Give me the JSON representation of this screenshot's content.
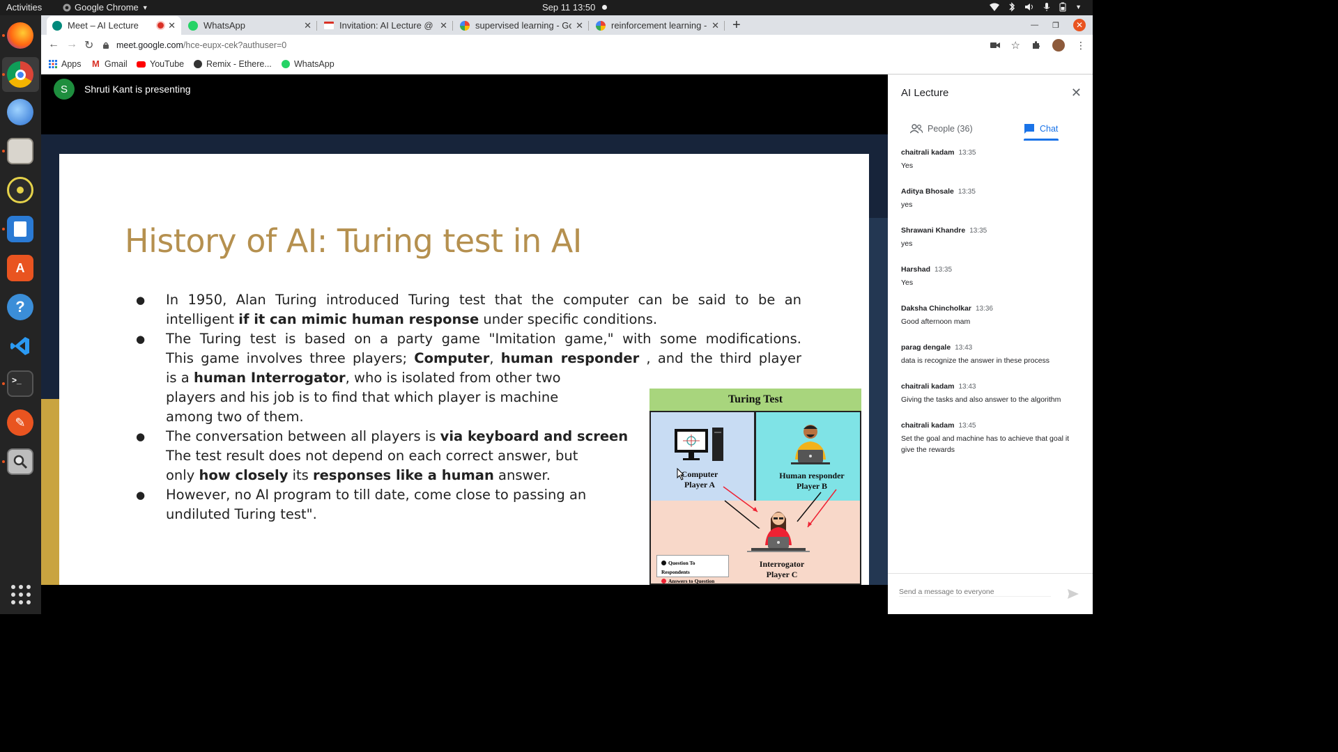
{
  "system": {
    "activities": "Activities",
    "app_name": "Google Chrome",
    "clock": "Sep 11  13:50"
  },
  "browser": {
    "tabs": [
      {
        "title": "Meet – AI Lecture",
        "active": true
      },
      {
        "title": "WhatsApp",
        "active": false
      },
      {
        "title": "Invitation: AI Lecture @ Fr",
        "active": false
      },
      {
        "title": "supervised learning - Goo",
        "active": false
      },
      {
        "title": "reinforcement learning - G",
        "active": false
      }
    ],
    "new_tab": "+",
    "url_host": "meet.google.com",
    "url_path": "/hce-eupx-cek?authuser=0",
    "bookmarks": [
      "Apps",
      "Gmail",
      "YouTube",
      "Remix - Ethere...",
      "WhatsApp"
    ]
  },
  "meet": {
    "presenter_initial": "S",
    "presenter_text": "Shruti Kant is presenting"
  },
  "slide": {
    "title": "History of AI: Turing test in AI",
    "figure": {
      "title": "Turing Test",
      "player_a": [
        "Computer",
        "Player A"
      ],
      "player_b": [
        "Human responder",
        "Player B"
      ],
      "player_c": [
        "Interrogator",
        "Player C"
      ],
      "legend_q": "Question To Respondents",
      "legend_a": "Answers to Question"
    }
  },
  "panel": {
    "title": "AI Lecture",
    "people_tab": "People (36)",
    "chat_tab": "Chat",
    "messages": [
      {
        "name": "chaitrali kadam",
        "time": "13:35",
        "text": "Yes"
      },
      {
        "name": "Aditya Bhosale",
        "time": "13:35",
        "text": "yes"
      },
      {
        "name": "Shrawani Khandre",
        "time": "13:35",
        "text": "yes"
      },
      {
        "name": "Harshad",
        "time": "13:35",
        "text": "Yes"
      },
      {
        "name": "Daksha Chincholkar",
        "time": "13:36",
        "text": "Good afternoon mam"
      },
      {
        "name": "parag dengale",
        "time": "13:43",
        "text": "data is recognize the answer in these process"
      },
      {
        "name": "chaitrali kadam",
        "time": "13:43",
        "text": "Giving the tasks and also answer to the algorithm"
      },
      {
        "name": "chaitrali kadam",
        "time": "13:45",
        "text": "Set the goal and machine has to achieve that goal it give the rewards"
      }
    ],
    "compose_placeholder": "Send a message to everyone"
  },
  "colors": {
    "slide_title": "#b5904f",
    "chat_accent": "#1a73e8",
    "ubuntu_orange": "#e95420"
  }
}
